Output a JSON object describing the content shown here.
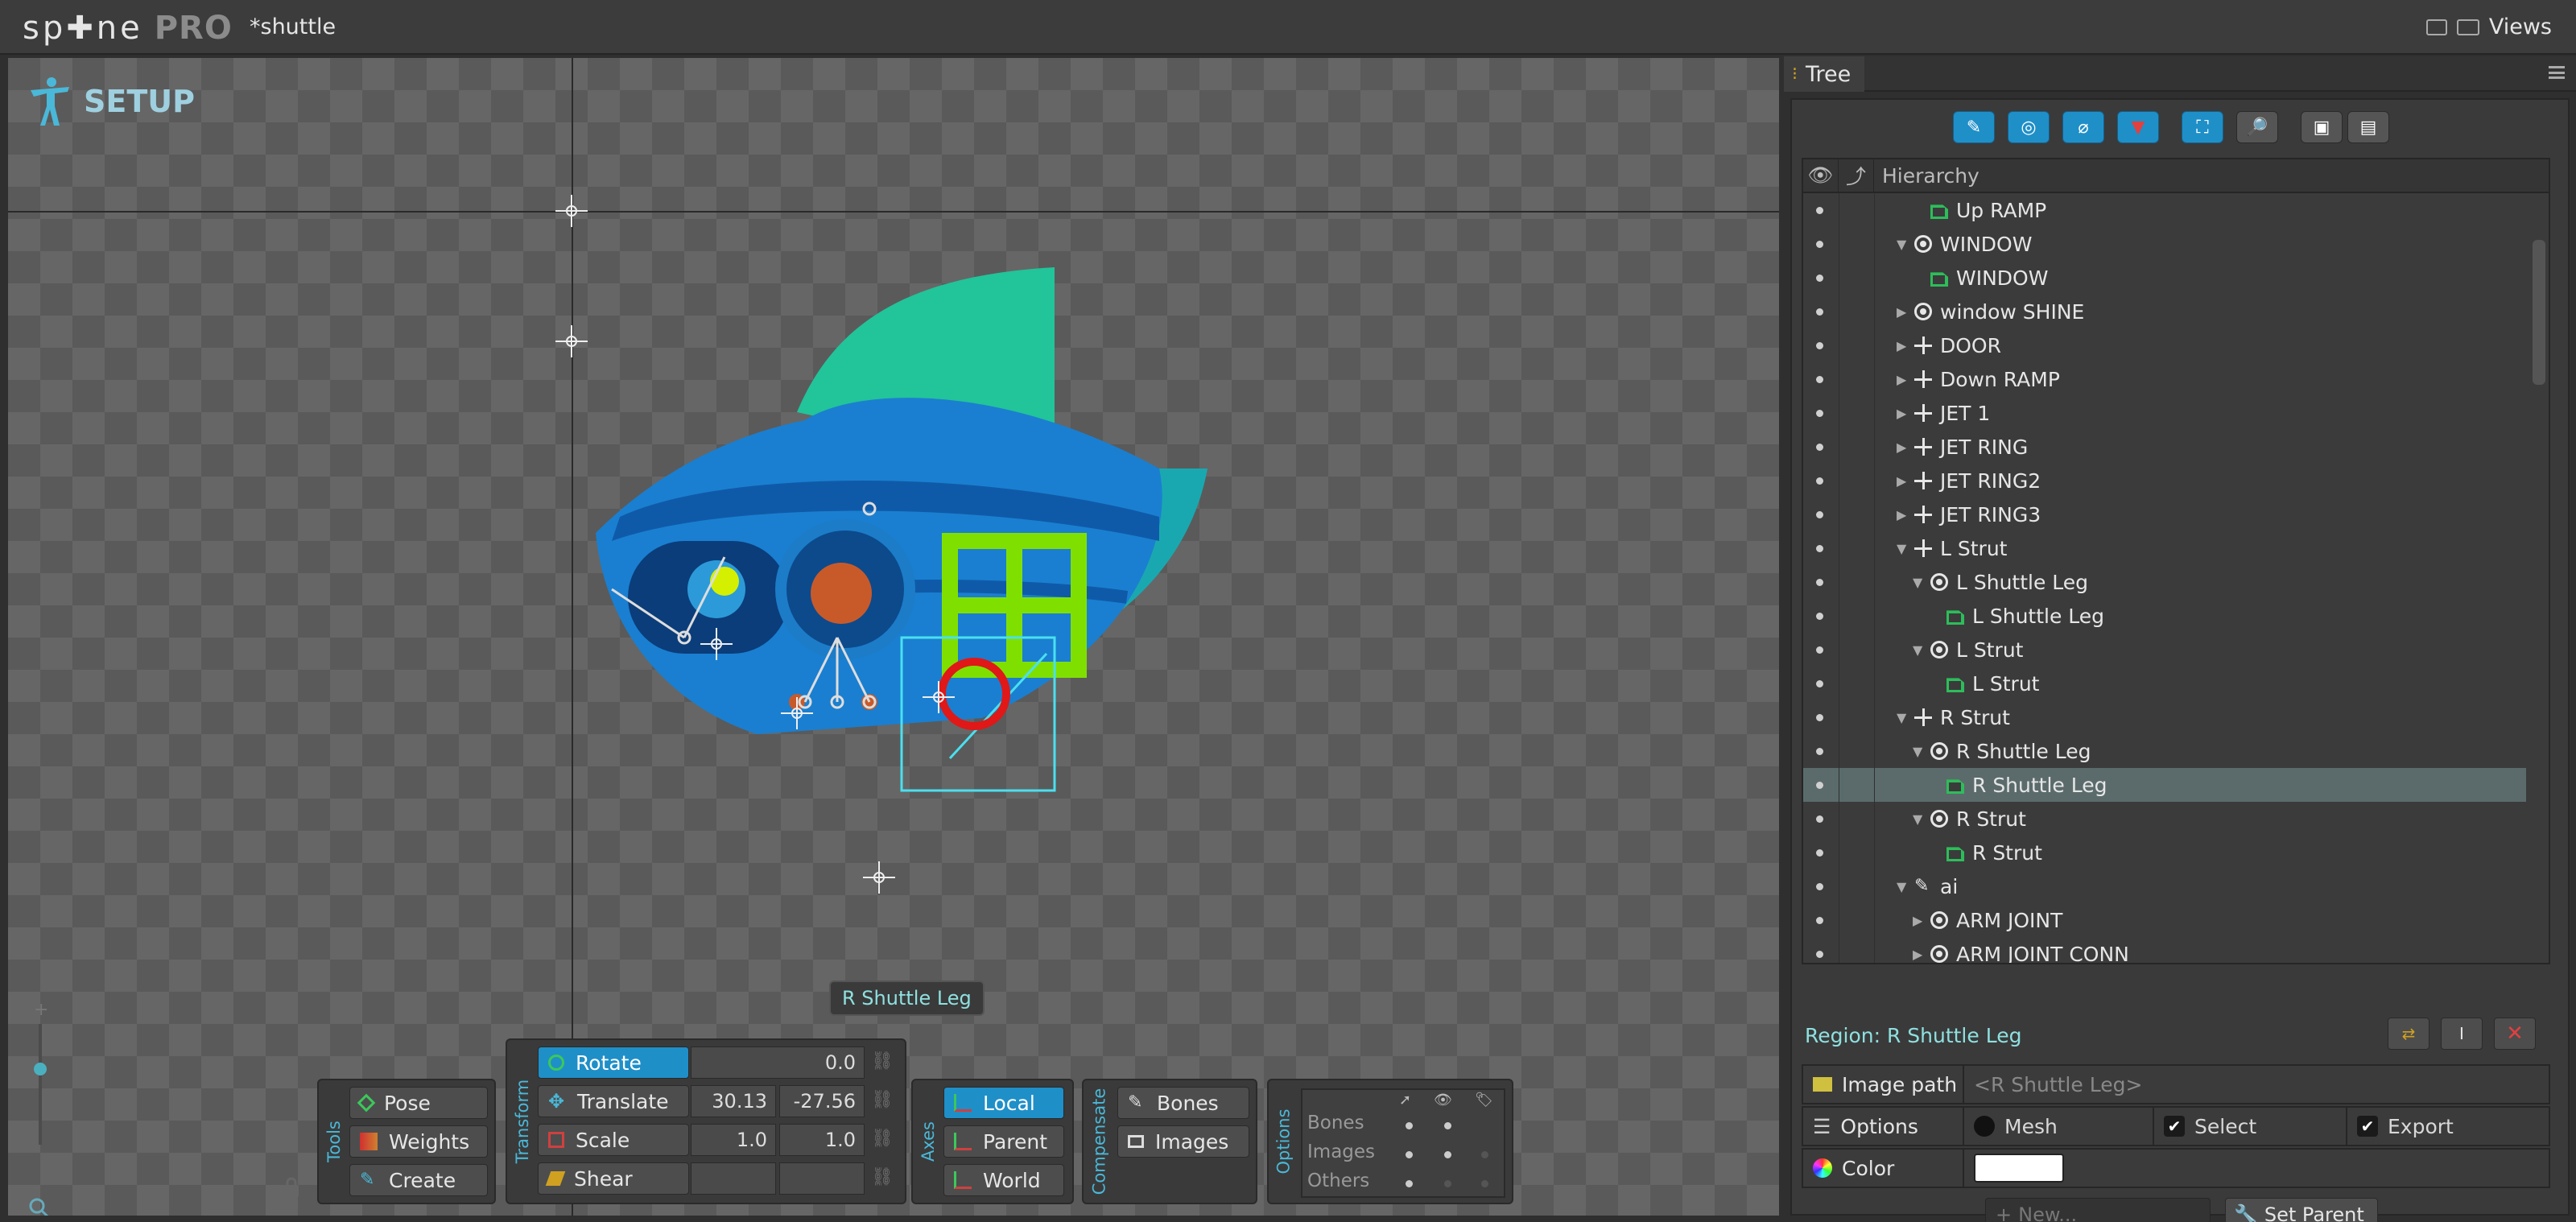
{
  "app": {
    "logo": "sp✚ne",
    "edition": "PRO",
    "title": "*shuttle",
    "views_label": "Views"
  },
  "viewport": {
    "mode_label": "SETUP",
    "tooltip": "R Shuttle Leg"
  },
  "tools": {
    "section_label": "Tools",
    "pose": "Pose",
    "weights": "Weights",
    "create": "Create"
  },
  "transform": {
    "section_label": "Transform",
    "rotate": {
      "label": "Rotate",
      "value": "0.0"
    },
    "translate": {
      "label": "Translate",
      "x": "30.13",
      "y": "-27.56"
    },
    "scale": {
      "label": "Scale",
      "x": "1.0",
      "y": "1.0"
    },
    "shear": {
      "label": "Shear"
    }
  },
  "axes": {
    "section_label": "Axes",
    "local": "Local",
    "parent": "Parent",
    "world": "World"
  },
  "compensate": {
    "section_label": "Compensate",
    "bones": "Bones",
    "images": "Images"
  },
  "options": {
    "section_label": "Options",
    "rows": [
      "Bones",
      "Images",
      "Others"
    ]
  },
  "tree": {
    "tab_label": "Tree",
    "header": "Hierarchy",
    "items": [
      {
        "label": "Up RAMP",
        "type": "region",
        "depth": 3,
        "arrow": ""
      },
      {
        "label": "WINDOW",
        "type": "slot",
        "depth": 2,
        "arrow": "▼"
      },
      {
        "label": "WINDOW",
        "type": "region",
        "depth": 3,
        "arrow": ""
      },
      {
        "label": "window SHINE",
        "type": "slot",
        "depth": 2,
        "arrow": "▶"
      },
      {
        "label": "DOOR",
        "type": "bone",
        "depth": 2,
        "arrow": "▶"
      },
      {
        "label": "Down RAMP",
        "type": "bone",
        "depth": 2,
        "arrow": "▶"
      },
      {
        "label": "JET 1",
        "type": "bone",
        "depth": 2,
        "arrow": "▶"
      },
      {
        "label": "JET RING",
        "type": "bone",
        "depth": 2,
        "arrow": "▶"
      },
      {
        "label": "JET RING2",
        "type": "bone",
        "depth": 2,
        "arrow": "▶"
      },
      {
        "label": "JET RING3",
        "type": "bone",
        "depth": 2,
        "arrow": "▶"
      },
      {
        "label": "L Strut",
        "type": "bone",
        "depth": 2,
        "arrow": "▼"
      },
      {
        "label": "L Shuttle Leg",
        "type": "slot",
        "depth": 3,
        "arrow": "▼"
      },
      {
        "label": "L Shuttle Leg",
        "type": "region",
        "depth": 4,
        "arrow": ""
      },
      {
        "label": "L Strut",
        "type": "slot",
        "depth": 3,
        "arrow": "▼"
      },
      {
        "label": "L Strut",
        "type": "region",
        "depth": 4,
        "arrow": ""
      },
      {
        "label": "R Strut",
        "type": "bone",
        "depth": 2,
        "arrow": "▼"
      },
      {
        "label": "R Shuttle Leg",
        "type": "slot",
        "depth": 3,
        "arrow": "▼"
      },
      {
        "label": "R Shuttle Leg",
        "type": "region",
        "depth": 4,
        "arrow": "",
        "selected": true
      },
      {
        "label": "R Strut",
        "type": "slot",
        "depth": 3,
        "arrow": "▼"
      },
      {
        "label": "R Strut",
        "type": "region",
        "depth": 4,
        "arrow": ""
      },
      {
        "label": "ai",
        "type": "brush",
        "depth": 2,
        "arrow": "▼"
      },
      {
        "label": "ARM JOINT",
        "type": "slot",
        "depth": 3,
        "arrow": "▶"
      },
      {
        "label": "ARM JOINT CONN",
        "type": "slot",
        "depth": 3,
        "arrow": "▶"
      }
    ]
  },
  "region": {
    "title": "Region: R Shuttle Leg",
    "image_path_label": "Image path",
    "image_path_value": "<R Shuttle Leg>",
    "options_label": "Options",
    "mesh_label": "Mesh",
    "mesh_checked": false,
    "select_label": "Select",
    "select_checked": true,
    "export_label": "Export",
    "export_checked": true,
    "color_label": "Color",
    "color_value": "#ffffff",
    "new_placeholder": "New...",
    "set_parent": "Set Parent"
  },
  "colors": {
    "accent": "#1f8fc8",
    "region_icon": "#2dbd5a",
    "shuttle_body": "#1a8fd0",
    "shuttle_fin": "#22c49a",
    "window_frame": "#7fe000",
    "selection_ring": "#e01818"
  }
}
